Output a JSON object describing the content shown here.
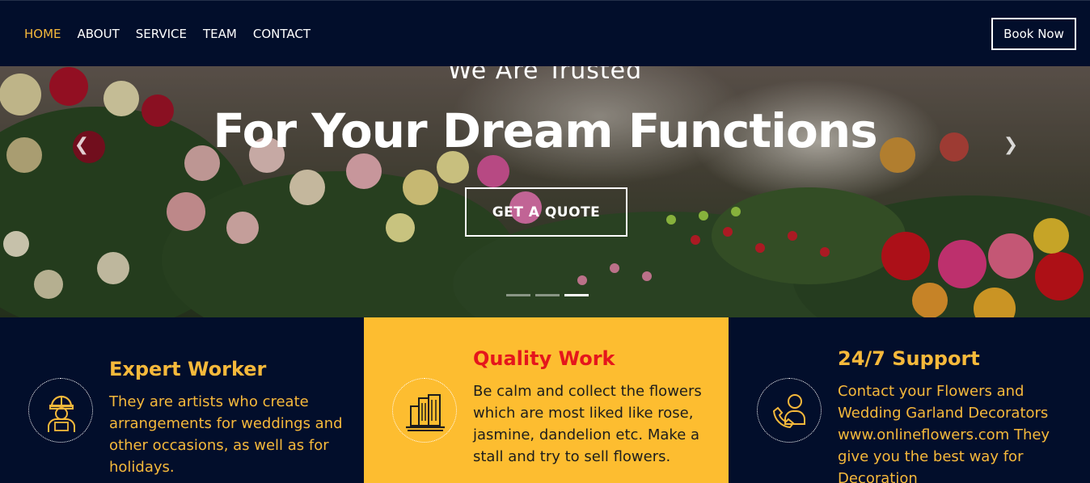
{
  "nav": {
    "links": [
      {
        "label": "HOME",
        "active": true
      },
      {
        "label": "ABOUT",
        "active": false
      },
      {
        "label": "SERVICE",
        "active": false
      },
      {
        "label": "TEAM",
        "active": false
      },
      {
        "label": "CONTACT",
        "active": false
      }
    ],
    "book_label": "Book Now"
  },
  "hero": {
    "subtitle": "We Are Trusted",
    "title": "For Your Dream Functions",
    "cta_label": "GET A QUOTE",
    "prev_icon": "chevron-left-icon",
    "next_icon": "chevron-right-icon",
    "slides_count": 3,
    "active_slide": 3
  },
  "features": [
    {
      "title": "Expert Worker",
      "text": "They are artists who create arrangements for weddings and other occasions, as well as for holidays.",
      "icon": "worker-icon"
    },
    {
      "title": "Quality Work",
      "text": "Be calm and collect the flowers which are most liked like rose, jasmine, dandelion etc. Make a stall and try to sell flowers.",
      "icon": "buildings-icon"
    },
    {
      "title": "24/7 Support",
      "text": "Contact your Flowers and Wedding Garland Decorators www.onlineflowers.com They give you the best way for Decoration",
      "icon": "support-phone-icon"
    }
  ],
  "colors": {
    "navy": "#020e2b",
    "accent": "#f6b93b",
    "yellow_panel": "#fdbd30",
    "red_title": "#e5161c"
  }
}
